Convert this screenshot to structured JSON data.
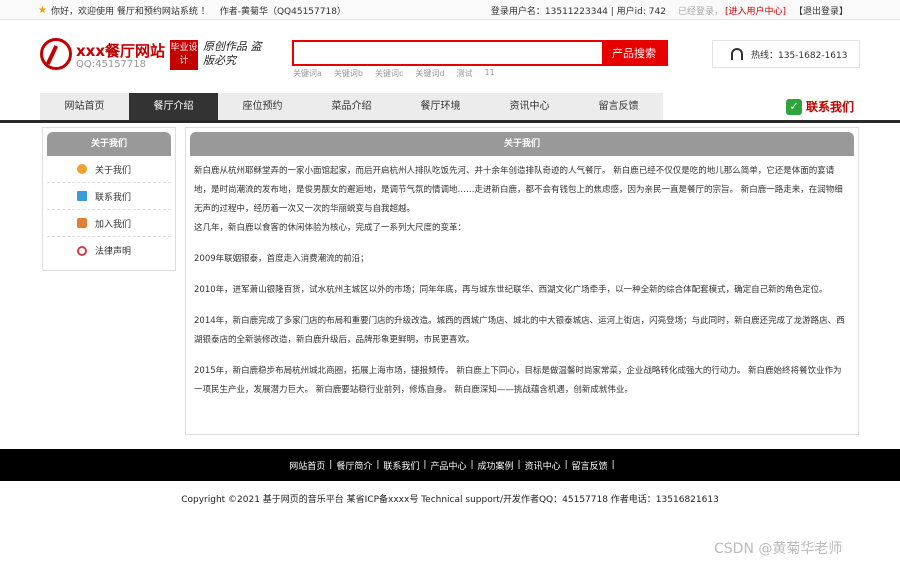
{
  "topbar": {
    "welcome": "你好，欢迎使用 餐厅和预约网站系统 ！",
    "author": "作者-黄菊华（QQ45157718）",
    "login_user": "登录用户名：13511223344 | 用户id: 742",
    "logged_in": "已经登录，",
    "user_center": "[进入用户中心]",
    "logout": "【退出登录】"
  },
  "header": {
    "logo_title": "xxx餐厅网站",
    "logo_qq": "QQ:45157718",
    "badge": "毕业设计",
    "slogan": "原创作品 盗版必究",
    "search_placeholder": "",
    "search_button": "产品搜索",
    "hot_keywords": [
      "关键词a",
      "关键词b",
      "关键词c",
      "关键词d",
      "测试",
      "11"
    ],
    "hotline": "热线：135-1682-1613"
  },
  "nav": {
    "items": [
      "网站首页",
      "餐厅介绍",
      "座位预约",
      "菜品介绍",
      "餐厅环境",
      "资讯中心",
      "留言反馈"
    ],
    "contact": "联系我们"
  },
  "sidebar": {
    "title": "关于我们",
    "items": [
      {
        "label": "关于我们",
        "color": "#f0a030"
      },
      {
        "label": "联系我们",
        "color": "#3a9ad9"
      },
      {
        "label": "加入我们",
        "color": "#e08030"
      },
      {
        "label": "法律声明",
        "color": "#d04040"
      }
    ]
  },
  "main": {
    "title": "关于我们",
    "paragraphs": [
      "新白鹿从杭州耶稣堂弄的一家小面馆起家，而后开启杭州人排队吃饭先河、并十余年创造排队奇迹的人气餐厅。 新白鹿已经不仅仅是吃的地儿那么简单，它还是体面的宴请地，是时尚潮流的发布地，是俊男靓女的邂逅地，是调节气氛的情调地……走进新白鹿，都不会有钱包上的焦虑感，因为亲民一直是餐厅的宗旨。 新白鹿一路走来，在润物细无声的过程中，经历着一次又一次的华丽蜕变与自我超越。",
      "这几年，新白鹿以食客的休闲体验为核心，完成了一系列大尺度的变革：",
      "2009年联姻银泰，首度走入消费潮流的前沿；",
      "2010年，进军萧山银隆百货，试水杭州主城区以外的市场；同年年底，再与城东世纪联华、西湖文化广场牵手，以一种全新的综合体配套模式，确定自己新的角色定位。",
      "2014年，新白鹿完成了多家门店的布局和重要门店的升级改造。城西的西城广场店、城北的中大银泰城店、运河上街店，闪亮登场；与此同时，新白鹿还完成了龙游路店、西湖银泰店的全新装修改造，新白鹿升级后，品牌形象更鲜明，市民更喜欢。",
      "2015年，新白鹿稳步布局杭州城北商圈，拓展上海市场，捷报频传。 新白鹿上下同心，目标是做温馨时尚家常菜，企业战略转化成强大的行动力。 新白鹿始终将餐饮业作为一项民生产业，发展潜力巨大。 新白鹿要站稳行业前列，修炼自身。 新白鹿深知——挑战蕴含机遇，创新成就伟业。"
    ]
  },
  "footer": {
    "links": [
      "网站首页",
      "餐厅简介",
      "联系我们",
      "产品中心",
      "成功案例",
      "资讯中心",
      "留言反馈"
    ],
    "copyright": "Copyright ©2021 基于网页的音乐平台    某省ICP备xxxx号    Technical support/开发作者QQ：45157718    作者电话：13516821613"
  },
  "watermark": "CSDN @黄菊华老师"
}
